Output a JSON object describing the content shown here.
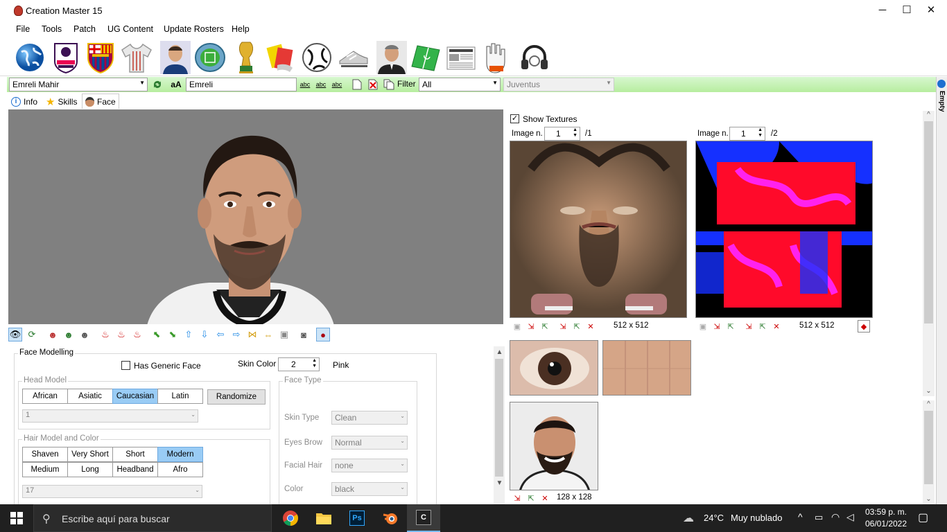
{
  "window": {
    "title": "Creation Master 15",
    "minimize": "─",
    "maximize": "☐",
    "close": "✕"
  },
  "menu": [
    "File",
    "Tools",
    "Patch",
    "UG Content",
    "Update Rosters",
    "Help"
  ],
  "toolbar_icons": [
    "globe-icon",
    "premier-league-logo-icon",
    "fc-barcelona-crest-icon",
    "kit-shirt-icon",
    "player-portrait-icon",
    "stadium-icon",
    "world-cup-trophy-icon",
    "referee-cards-icon",
    "match-ball-icon",
    "football-boots-icon",
    "manager-portrait-icon",
    "pitch-icon",
    "newspaper-icon",
    "goalkeeper-gloves-icon",
    "headphones-icon"
  ],
  "selector": {
    "player": "Emreli Mahir",
    "name_field": "Emreli",
    "filter_label": "Filter",
    "filter_value": "All",
    "team": "Juventus",
    "font_button": "aA",
    "abc": "abc"
  },
  "tabs": [
    {
      "label": "Info"
    },
    {
      "label": "Skills"
    },
    {
      "label": "Face"
    }
  ],
  "face_modelling": {
    "group_label": "Face Modelling",
    "generic_face_label": "Has Generic Face",
    "skin_color_label": "Skin Color",
    "skin_color_value": "2",
    "skin_color_name": "Pink",
    "head_model_label": "Head Model",
    "head_models": [
      "African",
      "Asiatic",
      "Caucasian",
      "Latin"
    ],
    "head_model_selected": "Caucasian",
    "randomize": "Randomize",
    "head_index": "1",
    "hair_label": "Hair Model and Color",
    "hair_models": [
      "Shaven",
      "Very Short",
      "Short",
      "Modern",
      "Medium",
      "Long",
      "Headband",
      "Afro"
    ],
    "hair_selected": "Modern",
    "hair_index": "17",
    "face_type_label": "Face Type",
    "skin_type_label": "Skin Type",
    "skin_type": "Clean",
    "eyes_brow_label": "Eyes Brow",
    "eyes_brow": "Normal",
    "facial_hair_label": "Facial Hair",
    "facial_hair": "none",
    "color_label": "Color",
    "color": "black"
  },
  "textures": {
    "show_label": "Show Textures",
    "image1": {
      "label": "Image n.",
      "value": "1",
      "total": "/1",
      "size": "512 x 512"
    },
    "image2": {
      "label": "Image n.",
      "value": "1",
      "total": "/2",
      "size": "512 x 512"
    },
    "photo_size": "128 x 128"
  },
  "side_label": "Empty",
  "taskbar": {
    "search_placeholder": "Escribe aquí para buscar",
    "weather_temp": "24°C",
    "weather_desc": "Muy nublado",
    "time": "03:59 p. m.",
    "date": "06/01/2022"
  }
}
